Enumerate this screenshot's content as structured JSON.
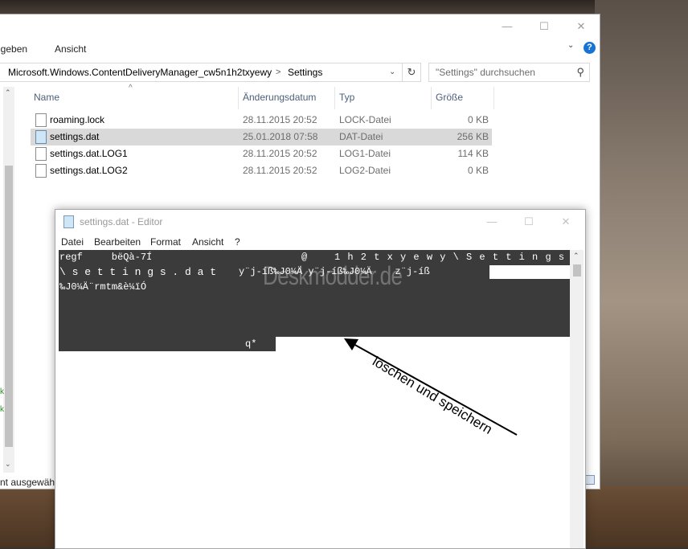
{
  "explorer": {
    "ribbon_tabs": [
      "igeben",
      "Ansicht"
    ],
    "caption_buttons": [
      "—",
      "☐",
      "✕"
    ],
    "address": {
      "path_segment_1": "Microsoft.Windows.ContentDeliveryManager_cw5n1h2txyewy",
      "separator": ">",
      "path_segment_2": "Settings",
      "dropdown_glyph": "⌄",
      "refresh_glyph": "↻"
    },
    "search": {
      "placeholder": "\"Settings\" durchsuchen"
    },
    "columns": [
      "Name",
      "Änderungsdatum",
      "Typ",
      "Größe"
    ],
    "files": [
      {
        "name": "roaming.lock",
        "date": "28.11.2015 20:52",
        "type": "LOCK-Datei",
        "size": "0 KB",
        "selected": false,
        "icon": "file-icon"
      },
      {
        "name": "settings.dat",
        "date": "25.01.2018 07:58",
        "type": "DAT-Datei",
        "size": "256 KB",
        "selected": true,
        "icon": "dat-file-icon"
      },
      {
        "name": "settings.dat.LOG1",
        "date": "28.11.2015 20:52",
        "type": "LOG1-Datei",
        "size": "114 KB",
        "selected": false,
        "icon": "file-icon"
      },
      {
        "name": "settings.dat.LOG2",
        "date": "28.11.2015 20:52",
        "type": "LOG2-Datei",
        "size": "0 KB",
        "selected": false,
        "icon": "file-icon"
      }
    ],
    "status_text": "nt ausgewähl",
    "nav_marks": [
      "k",
      "k"
    ]
  },
  "editor": {
    "title": "settings.dat - Editor",
    "caption_buttons": [
      "—",
      "☐",
      "✕"
    ],
    "menu": [
      "Datei",
      "Bearbeiten",
      "Format",
      "Ansicht",
      "?"
    ],
    "text_lines": [
      "regf     bëQà-7Í         ",
      "\\ s e t t i n g s . d a t",
      "‰J0¼Ä¨rmtm&è¼ïÓ"
    ],
    "line1_tail": "@    1 h 2 t x y e w y \\ S e t t i n g s",
    "line2_tail": "y¨j-íß‰J0¼Ä y¨j-íß‰J0¼Ä    z¨j-íß",
    "cursor_text": "q*",
    "watermark": "Deskmodder.de"
  },
  "annotation": {
    "text": "löschen und speichern",
    "color": "#000000"
  }
}
